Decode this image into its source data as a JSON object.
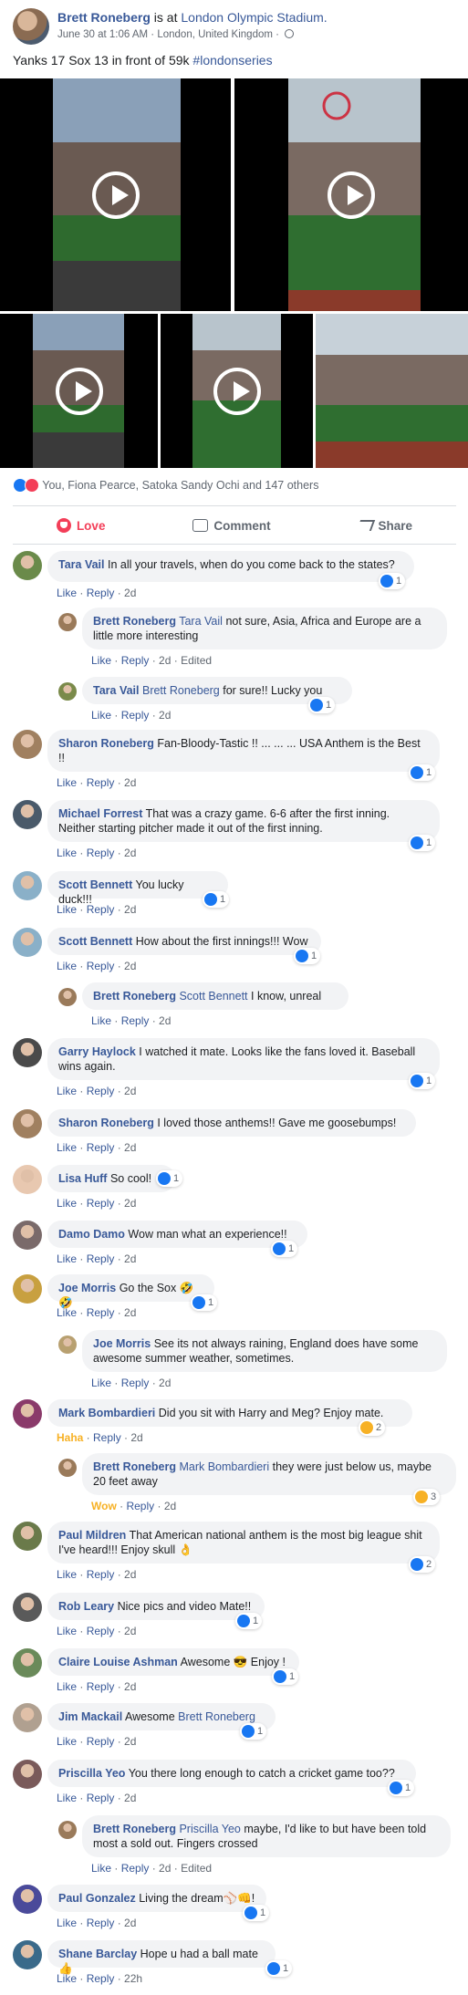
{
  "post": {
    "author": "Brett Roneberg",
    "is_at": "is at",
    "location": "London Olympic Stadium.",
    "date": "June 30 at 1:06 AM",
    "place": "London, United Kingdom",
    "text": "Yanks 17 Sox 13 in front of 59k",
    "hashtag": "#londonseries"
  },
  "reactions_summary": "You, Fiona Pearce, Satoka Sandy Ochi and 147 others",
  "actions": {
    "love": "Love",
    "comment": "Comment",
    "share": "Share"
  },
  "colors": {
    "link": "#385898",
    "like_blue": "#1877f2",
    "love_red": "#f33e58",
    "haha_yellow": "#f7b125",
    "bubble_bg": "#f2f3f5"
  },
  "comments": [
    {
      "name": "Tara Vail",
      "text": "In all your travels, when do you come back to the states?",
      "like": "Like",
      "reply": "Reply",
      "time": "2d",
      "count": "1"
    },
    {
      "name": "Brett Roneberg",
      "mention": "Tara Vail",
      "text": "not sure, Asia, Africa and Europe are a little more interesting",
      "like": "Like",
      "reply": "Reply",
      "time": "2d",
      "edited": "Edited"
    },
    {
      "name": "Tara Vail",
      "mention": "Brett Roneberg",
      "text": "for sure!! Lucky you",
      "like": "Like",
      "reply": "Reply",
      "time": "2d",
      "count": "1"
    },
    {
      "name": "Sharon Roneberg",
      "text": "Fan-Bloody-Tastic !! ... ... ... USA Anthem is the Best !!",
      "like": "Like",
      "reply": "Reply",
      "time": "2d",
      "count": "1"
    },
    {
      "name": "Michael Forrest",
      "text": "That was a crazy game. 6-6 after the first inning. Neither starting pitcher made it out of the first inning.",
      "like": "Like",
      "reply": "Reply",
      "time": "2d",
      "count": "1"
    },
    {
      "name": "Scott Bennett",
      "text": "You lucky duck!!!",
      "like": "Like",
      "reply": "Reply",
      "time": "2d",
      "count": "1"
    },
    {
      "name": "Scott Bennett",
      "text": "How about the first innings!!! Wow",
      "like": "Like",
      "reply": "Reply",
      "time": "2d",
      "count": "1"
    },
    {
      "name": "Brett Roneberg",
      "mention": "Scott Bennett",
      "text": "I know, unreal",
      "like": "Like",
      "reply": "Reply",
      "time": "2d"
    },
    {
      "name": "Garry Haylock",
      "text": "I watched it mate. Looks like the fans loved it. Baseball wins again.",
      "like": "Like",
      "reply": "Reply",
      "time": "2d",
      "count": "1"
    },
    {
      "name": "Sharon Roneberg",
      "text": "I loved those anthems!! Gave me goosebumps!",
      "like": "Like",
      "reply": "Reply",
      "time": "2d"
    },
    {
      "name": "Lisa Huff",
      "text": "So cool!",
      "like": "Like",
      "reply": "Reply",
      "time": "2d",
      "count": "1"
    },
    {
      "name": "Damo Damo",
      "text": "Wow man what an experience!!",
      "like": "Like",
      "reply": "Reply",
      "time": "2d",
      "count": "1"
    },
    {
      "name": "Joe Morris",
      "text": "Go the Sox 🤣🤣",
      "like": "Like",
      "reply": "Reply",
      "time": "2d",
      "count": "1"
    },
    {
      "name": "Joe Morris",
      "text": "See its not always raining, England does have some awesome summer weather, sometimes.",
      "like": "Like",
      "reply": "Reply",
      "time": "2d"
    },
    {
      "name": "Mark Bombardieri",
      "text": "Did you sit with Harry and Meg? Enjoy mate.",
      "like": "Haha",
      "reply": "Reply",
      "time": "2d",
      "count": "2"
    },
    {
      "name": "Brett Roneberg",
      "mention": "Mark Bombardieri",
      "text": "they were just below us, maybe 20 feet away",
      "like": "Wow",
      "reply": "Reply",
      "time": "2d",
      "count": "3"
    },
    {
      "name": "Paul Mildren",
      "text": "That American national anthem is the most big league shit I've heard!!! Enjoy skull 👌",
      "like": "Like",
      "reply": "Reply",
      "time": "2d",
      "count": "2"
    },
    {
      "name": "Rob Leary",
      "text": "Nice pics and video Mate!!",
      "like": "Like",
      "reply": "Reply",
      "time": "2d",
      "count": "1"
    },
    {
      "name": "Claire Louise Ashman",
      "text": "Awesome 😎 Enjoy !",
      "like": "Like",
      "reply": "Reply",
      "time": "2d",
      "count": "1"
    },
    {
      "name": "Jim Mackail",
      "text": "Awesome",
      "mention_after": "Brett Roneberg",
      "like": "Like",
      "reply": "Reply",
      "time": "2d",
      "count": "1"
    },
    {
      "name": "Priscilla Yeo",
      "text": "You there long enough to catch a cricket game too??",
      "like": "Like",
      "reply": "Reply",
      "time": "2d",
      "count": "1"
    },
    {
      "name": "Brett Roneberg",
      "mention": "Priscilla Yeo",
      "text": "maybe, I'd like to but have been told most a sold out. Fingers crossed",
      "like": "Like",
      "reply": "Reply",
      "time": "2d",
      "edited": "Edited"
    },
    {
      "name": "Paul Gonzalez",
      "text": "Living the dream⚾👊!",
      "like": "Like",
      "reply": "Reply",
      "time": "2d",
      "count": "1"
    },
    {
      "name": "Shane Barclay",
      "text": "Hope u had a ball mate👍",
      "like": "Like",
      "reply": "Reply",
      "time": "22h",
      "count": "1"
    }
  ]
}
